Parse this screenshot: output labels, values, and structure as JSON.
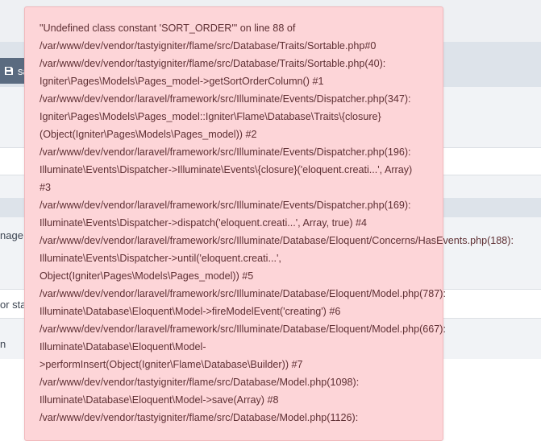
{
  "background": {
    "save_label": "sa",
    "label_page": "nage",
    "label_status": "or sta",
    "label_n": "n"
  },
  "error": {
    "lines": [
      "\"Undefined class constant 'SORT_ORDER'\" on line 88 of",
      "/var/www/dev/vendor/tastyigniter/flame/src/Database/Traits/Sortable.php#0",
      "/var/www/dev/vendor/tastyigniter/flame/src/Database/Traits/Sortable.php(40):",
      "Igniter\\Pages\\Models\\Pages_model->getSortOrderColumn() #1",
      "/var/www/dev/vendor/laravel/framework/src/Illuminate/Events/Dispatcher.php(347):",
      "Igniter\\Pages\\Models\\Pages_model::Igniter\\Flame\\Database\\Traits\\{closure}",
      "(Object(Igniter\\Pages\\Models\\Pages_model)) #2",
      "/var/www/dev/vendor/laravel/framework/src/Illuminate/Events/Dispatcher.php(196):",
      "Illuminate\\Events\\Dispatcher->Illuminate\\Events\\{closure}('eloquent.creati...', Array)",
      "#3",
      "/var/www/dev/vendor/laravel/framework/src/Illuminate/Events/Dispatcher.php(169):",
      "Illuminate\\Events\\Dispatcher->dispatch('eloquent.creati...', Array, true) #4",
      "/var/www/dev/vendor/laravel/framework/src/Illuminate/Database/Eloquent/Concerns/HasEvents.php(188):",
      "Illuminate\\Events\\Dispatcher->until('eloquent.creati...',",
      "Object(Igniter\\Pages\\Models\\Pages_model)) #5",
      "/var/www/dev/vendor/laravel/framework/src/Illuminate/Database/Eloquent/Model.php(787):",
      "Illuminate\\Database\\Eloquent\\Model->fireModelEvent('creating') #6",
      "/var/www/dev/vendor/laravel/framework/src/Illuminate/Database/Eloquent/Model.php(667):",
      "Illuminate\\Database\\Eloquent\\Model-",
      ">performInsert(Object(Igniter\\Flame\\Database\\Builder)) #7",
      "/var/www/dev/vendor/tastyigniter/flame/src/Database/Model.php(1098):",
      "Illuminate\\Database\\Eloquent\\Model->save(Array) #8",
      "/var/www/dev/vendor/tastyigniter/flame/src/Database/Model.php(1126):"
    ]
  }
}
